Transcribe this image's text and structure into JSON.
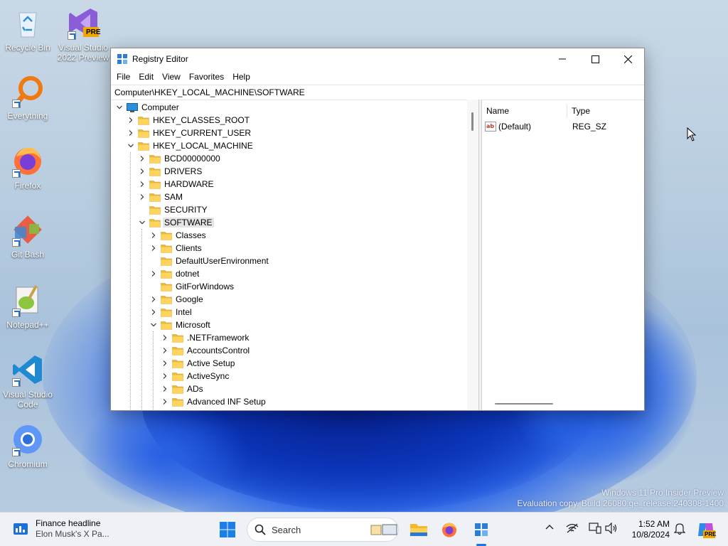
{
  "desktop": {
    "icons": [
      {
        "label": "Recycle Bin"
      },
      {
        "label": "Visual Studio 2022 Preview"
      },
      {
        "label": "Everything"
      },
      {
        "label": "Firefox"
      },
      {
        "label": "Git Bash"
      },
      {
        "label": "Notepad++"
      },
      {
        "label": "Visual Studio Code"
      },
      {
        "label": "Chromium"
      }
    ],
    "vs_badge": "PRE",
    "watermark_line1": "Windows 11 Pro Insider Preview",
    "watermark_line2": "Evaluation copy. Build 26080.ge_release.240308-1400"
  },
  "window": {
    "title": "Registry Editor",
    "menu": [
      "File",
      "Edit",
      "View",
      "Favorites",
      "Help"
    ],
    "address": "Computer\\HKEY_LOCAL_MACHINE\\SOFTWARE",
    "tree": [
      {
        "label": "Computer",
        "chev": "down"
      },
      {
        "label": "HKEY_CLASSES_ROOT",
        "chev": "right"
      },
      {
        "label": "HKEY_CURRENT_USER",
        "chev": "right"
      },
      {
        "label": "HKEY_LOCAL_MACHINE",
        "chev": "down"
      },
      {
        "label": "BCD00000000",
        "chev": "right"
      },
      {
        "label": "DRIVERS",
        "chev": "right"
      },
      {
        "label": "HARDWARE",
        "chev": "right"
      },
      {
        "label": "SAM",
        "chev": "right"
      },
      {
        "label": "SECURITY",
        "chev": "none"
      },
      {
        "label": "SOFTWARE",
        "chev": "down",
        "selected": true
      },
      {
        "label": "Classes",
        "chev": "right"
      },
      {
        "label": "Clients",
        "chev": "right"
      },
      {
        "label": "DefaultUserEnvironment",
        "chev": "none"
      },
      {
        "label": "dotnet",
        "chev": "right"
      },
      {
        "label": "GitForWindows",
        "chev": "none"
      },
      {
        "label": "Google",
        "chev": "right"
      },
      {
        "label": "Intel",
        "chev": "right"
      },
      {
        "label": "Microsoft",
        "chev": "down"
      },
      {
        "label": ".NETFramework",
        "chev": "right"
      },
      {
        "label": "AccountsControl",
        "chev": "right"
      },
      {
        "label": "Active Setup",
        "chev": "right"
      },
      {
        "label": "ActiveSync",
        "chev": "right"
      },
      {
        "label": "ADs",
        "chev": "right"
      },
      {
        "label": "Advanced INF Setup",
        "chev": "right"
      }
    ],
    "columns": {
      "name": "Name",
      "type": "Type"
    },
    "values": [
      {
        "name": "(Default)",
        "type": "REG_SZ"
      }
    ]
  },
  "taskbar": {
    "news_title": "Finance headline",
    "news_sub": "Elon Musk's X Pa...",
    "search_placeholder": "Search",
    "time": "1:52 AM",
    "date": "10/8/2024",
    "copilot_badge": "PRE"
  }
}
